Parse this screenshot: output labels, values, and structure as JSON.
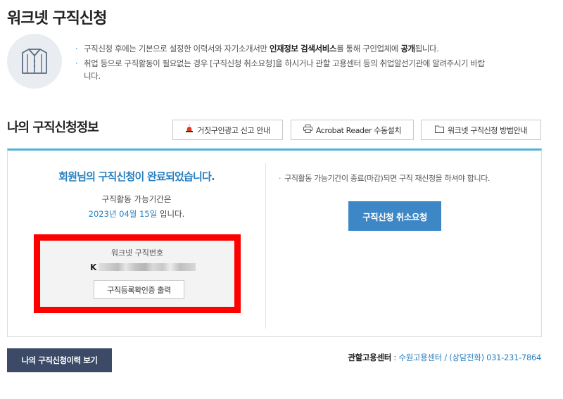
{
  "page": {
    "title": "워크넷 구직신청"
  },
  "notices": [
    {
      "parts": [
        "구직신청 후에는 기본으로 설정한 이력서와 자기소개서만 ",
        "인재정보 검색서비스",
        "를 통해 구인업체에 ",
        "공개",
        "됩니다."
      ]
    },
    {
      "line1": "취업 등으로 구직활동이 필요없는 경우 [구직신청 취소요청]을 하시거나 관할 고용센터 등의 취업알선기관에 알려주시기 바랍",
      "line2": "니다."
    }
  ],
  "section": {
    "title": "나의 구직신청정보"
  },
  "toolbar": {
    "report_label": "거짓구인광고 신고 안내",
    "acrobat_label": "Acrobat Reader 수동설치",
    "guide_label": "워크넷 구직신청 방법안내"
  },
  "status": {
    "complete_message": "회원님의 구직신청이 완료되었습니다.",
    "period_label": "구직활동 가능기간은",
    "period_date": "2023년 04월 15일",
    "period_suffix": " 입니다."
  },
  "job_number": {
    "label": "워크넷 구직번호",
    "value_prefix": "K",
    "print_label": "구직등록확인증 출력"
  },
  "right": {
    "note": "구직활동 가능기간이 종료(마감)되면 구직 재신청을 하셔야 합니다.",
    "cancel_label": "구직신청 취소요청"
  },
  "footer": {
    "history_label": "나의 구직신청이력 보기",
    "center_label": "관할고용센터",
    "center_value": "수원고용센터 / (상담전화) 031-231-7864"
  },
  "colors": {
    "accent": "#2a7fbe",
    "cancel_button": "#3d87c6",
    "history_button": "#3c4a67",
    "highlight": "#ff0000",
    "panel_top_border": "#4fb3d8"
  },
  "icons": [
    "shirt-icon",
    "siren-icon",
    "printer-icon",
    "folder-icon"
  ]
}
